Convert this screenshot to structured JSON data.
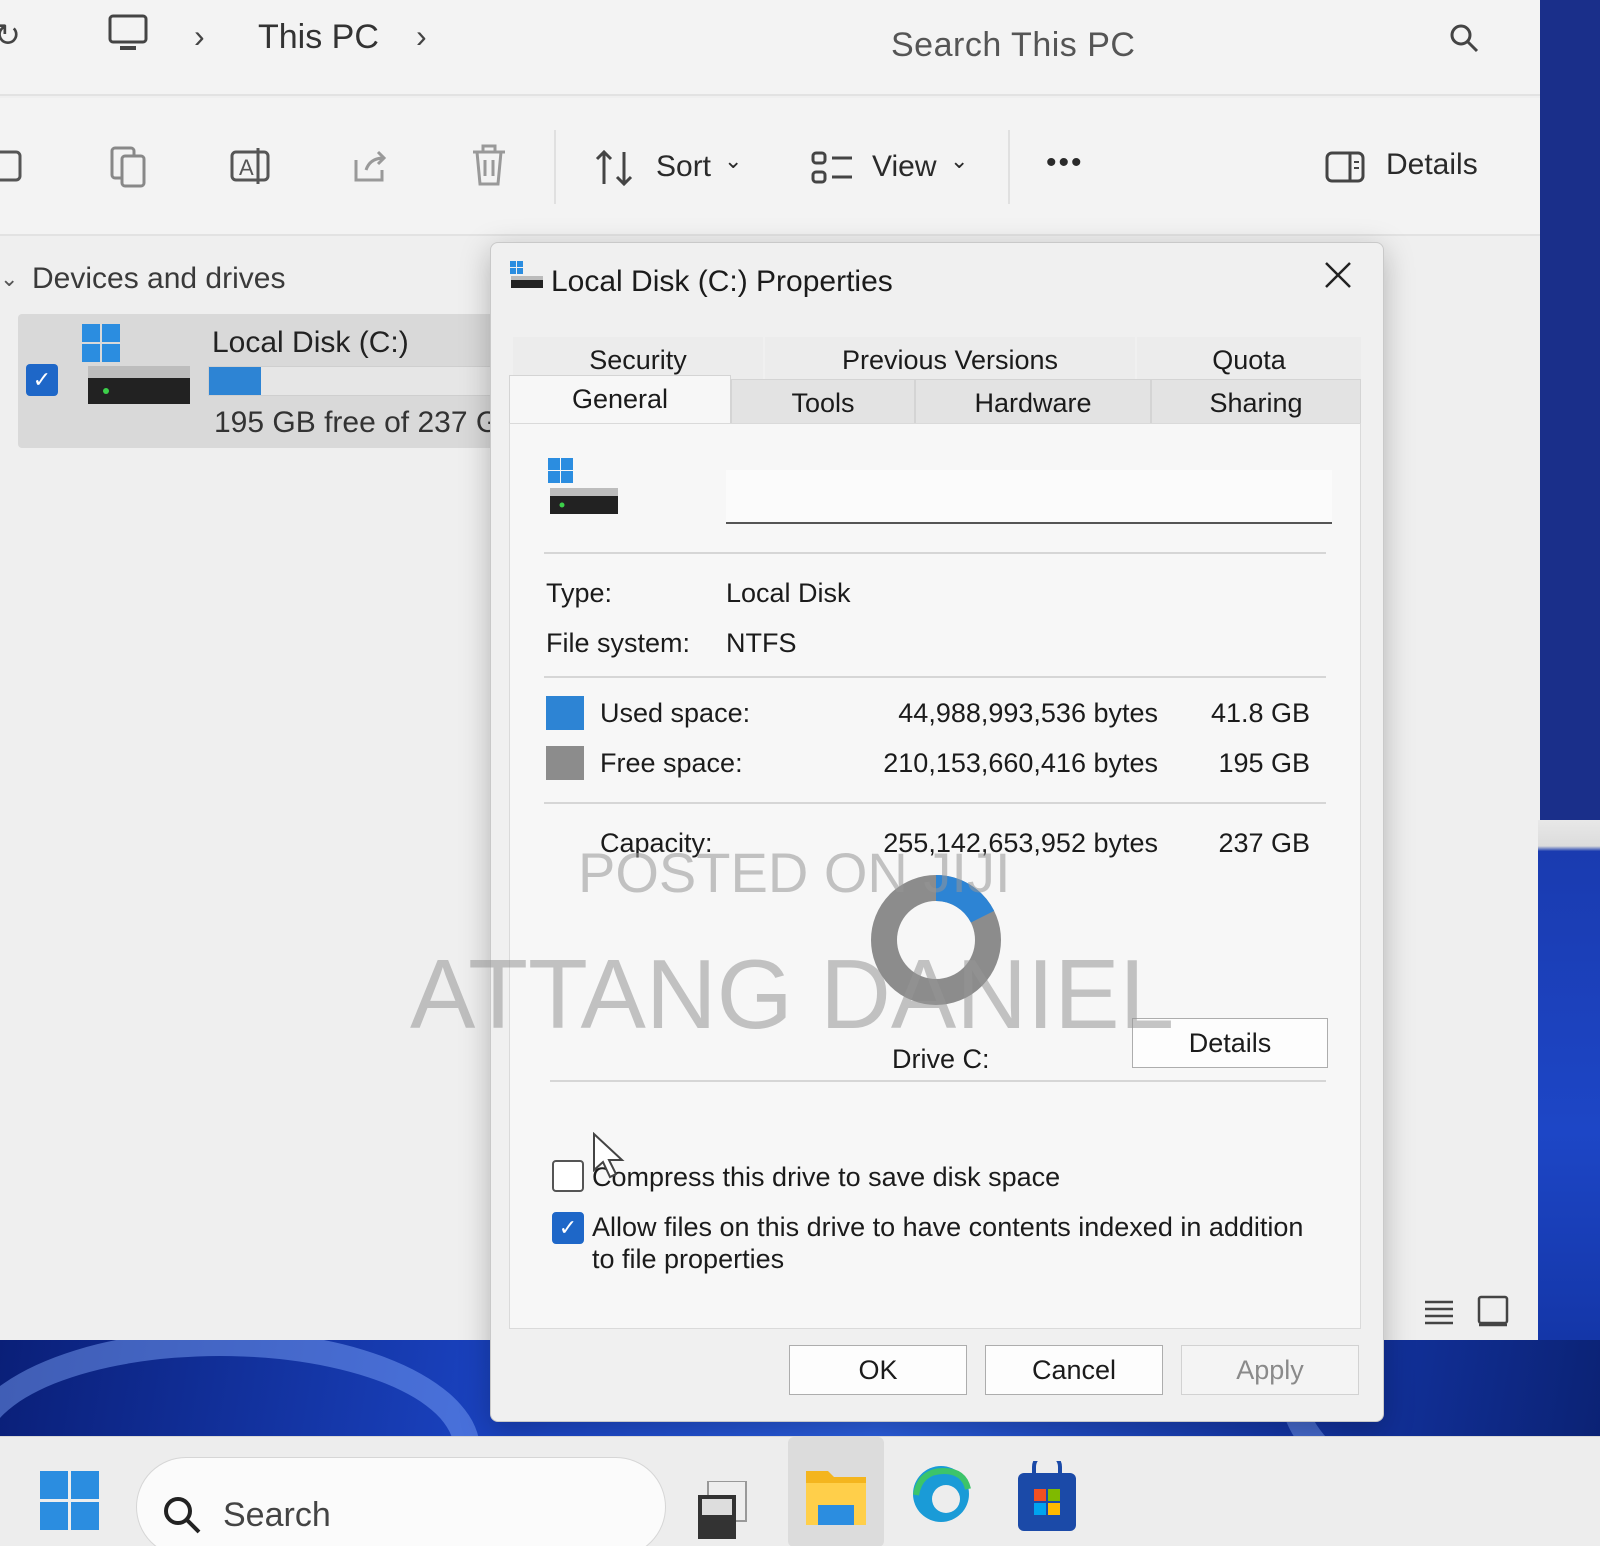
{
  "explorer": {
    "breadcrumb": [
      "This PC"
    ],
    "search_placeholder": "Search This PC",
    "toolbar": {
      "sort_label": "Sort",
      "view_label": "View",
      "more_label": "•••",
      "details_label": "Details"
    },
    "nav": {
      "section_header": "Devices and drives",
      "drive": {
        "name": "Local Disk (C:)",
        "free_text": "195 GB free of 237 G",
        "used_fraction": 0.176
      }
    }
  },
  "dialog": {
    "title": "Local Disk (C:) Properties",
    "tabs_top": [
      "Security",
      "Previous Versions",
      "Quota"
    ],
    "tabs_bottom": [
      "General",
      "Tools",
      "Hardware",
      "Sharing"
    ],
    "active_tab": "General",
    "volume_label_value": "",
    "type_label": "Type:",
    "type_value": "Local Disk",
    "fs_label": "File system:",
    "fs_value": "NTFS",
    "used": {
      "label": "Used space:",
      "bytes": "44,988,993,536 bytes",
      "size": "41.8 GB",
      "color": "#2d84d4"
    },
    "free": {
      "label": "Free space:",
      "bytes": "210,153,660,416 bytes",
      "size": "195 GB",
      "color": "#8c8c8c"
    },
    "capacity": {
      "label": "Capacity:",
      "bytes": "255,142,653,952 bytes",
      "size": "237 GB"
    },
    "used_fraction": 0.176,
    "drive_label": "Drive C:",
    "details_button": "Details",
    "compress_label": "Compress this drive to save disk space",
    "compress_checked": false,
    "index_label_line1": "Allow files on this drive to have contents indexed in addition",
    "index_label_line2": "to file properties",
    "index_checked": true,
    "ok_button": "OK",
    "cancel_button": "Cancel",
    "apply_button": "Apply"
  },
  "watermark": {
    "line1": "POSTED ON JIJI",
    "line2": "ATTANG DANIEL"
  },
  "taskbar": {
    "search_placeholder": "Search"
  }
}
